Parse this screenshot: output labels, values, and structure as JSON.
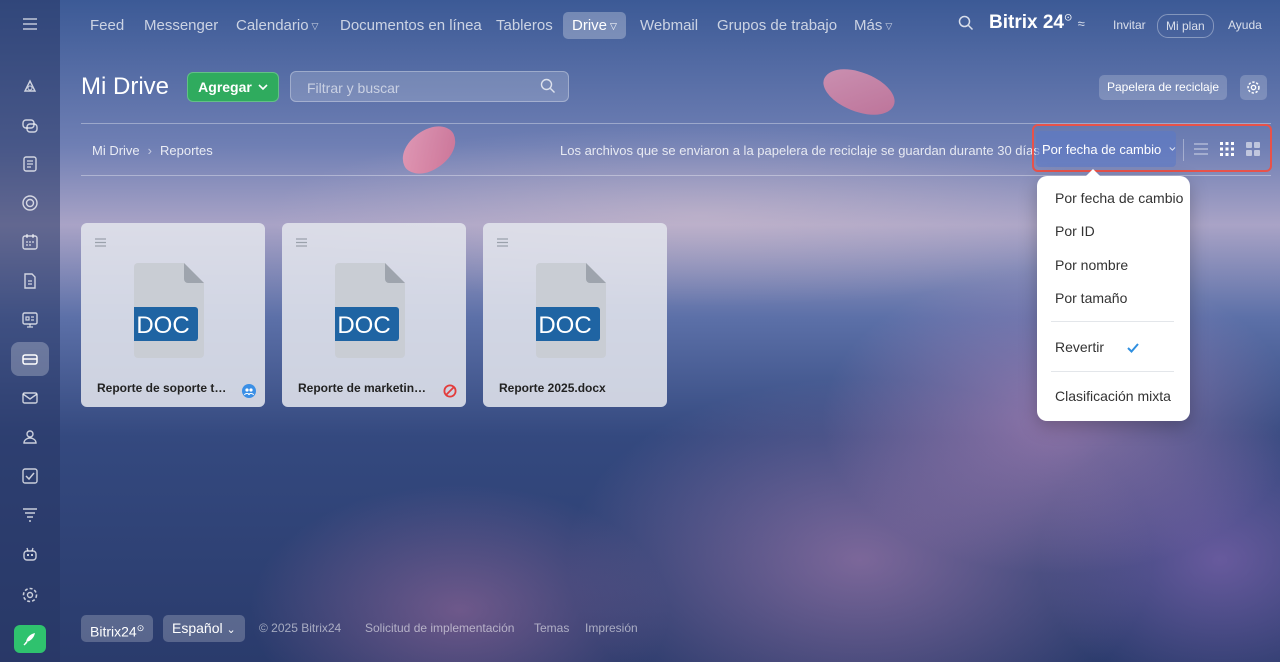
{
  "nav": {
    "items": [
      {
        "label": "Feed"
      },
      {
        "label": "Messenger"
      },
      {
        "label": "Calendario"
      },
      {
        "label": "Documentos en línea"
      },
      {
        "label": "Tableros"
      },
      {
        "label": "Drive"
      },
      {
        "label": "Webmail"
      },
      {
        "label": "Grupos de trabajo"
      },
      {
        "label": "Más"
      }
    ],
    "brand": "Bitrix 24",
    "invite": "Invitar",
    "plan": "Mi plan",
    "help": "Ayuda"
  },
  "header": {
    "title": "Mi Drive",
    "add_label": "Agregar",
    "search_placeholder": "Filtrar y buscar",
    "recycle_label": "Papelera de reciclaje"
  },
  "breadcrumb": [
    "Mi Drive",
    "Reportes"
  ],
  "notice": "Los archivos que se enviaron a la papelera de reciclaje se guardan durante 30 días",
  "sort": {
    "current": "Por fecha de cambio",
    "options": [
      "Por fecha de cambio",
      "Por ID",
      "Por nombre",
      "Por tamaño"
    ],
    "reverse": "Revertir",
    "mixed": "Clasificación mixta"
  },
  "files": [
    {
      "name": "Reporte de soporte técn...",
      "type": "DOC",
      "badge": "shared-icon"
    },
    {
      "name": "Reporte de marketing.d...",
      "type": "DOC",
      "badge": "blocked-icon"
    },
    {
      "name": "Reporte 2025.docx",
      "type": "DOC",
      "badge": ""
    }
  ],
  "footer": {
    "brand": "Bitrix24",
    "language": "Español",
    "links": [
      "© 2025 Bitrix24",
      "Solicitud de implementación",
      "Temas",
      "Impresión"
    ]
  },
  "colors": {
    "accent": "#2fab5e",
    "highlight": "#e8524a",
    "doc_blue": "#1f64a3"
  }
}
